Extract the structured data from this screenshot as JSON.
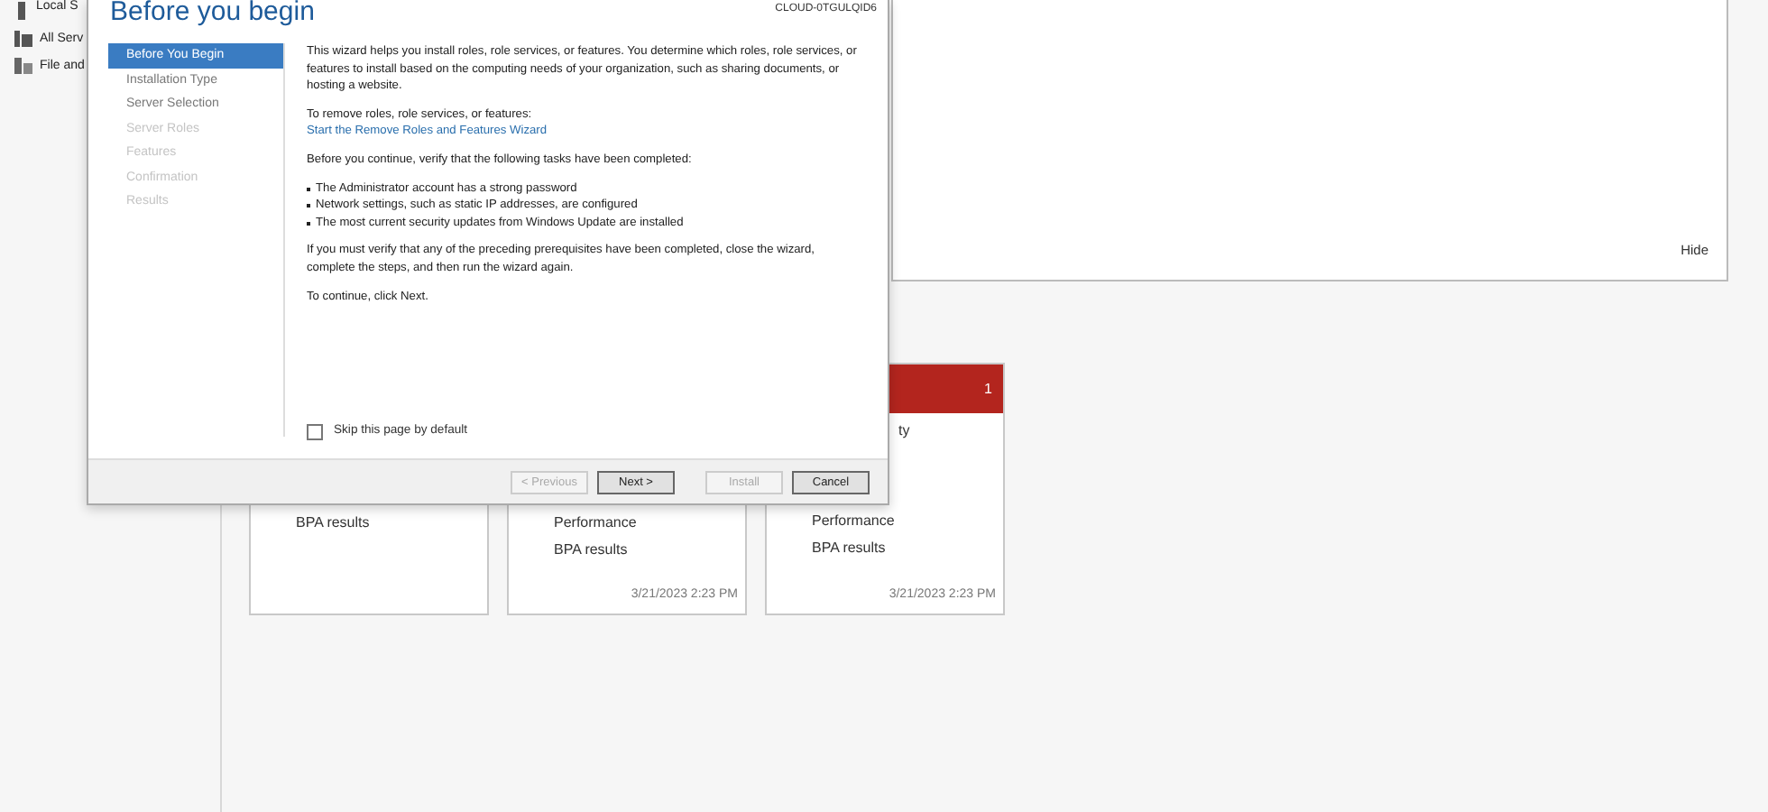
{
  "nav_items": [
    {
      "label": "Local S"
    },
    {
      "label": "All Serv"
    },
    {
      "label": "File and"
    }
  ],
  "panel": {
    "hide_link": "Hide"
  },
  "tiles": [
    {
      "items": [
        "BPA results"
      ]
    },
    {
      "items": [
        "Performance",
        "BPA results"
      ],
      "timestamp": "3/21/2023 2:23 PM"
    },
    {
      "alert": true,
      "count": "1",
      "partial_text": "ty",
      "items": [
        "Performance",
        "BPA results"
      ],
      "timestamp": "3/21/2023 2:23 PM"
    }
  ],
  "dialog": {
    "title": "Before you begin",
    "server_name": "CLOUD-0TGULQID6",
    "steps": [
      {
        "label": "Before You Begin",
        "selected": true,
        "disabled": false
      },
      {
        "label": "Installation Type",
        "selected": false,
        "disabled": false
      },
      {
        "label": "Server Selection",
        "selected": false,
        "disabled": false
      },
      {
        "label": "Server Roles",
        "selected": false,
        "disabled": true
      },
      {
        "label": "Features",
        "selected": false,
        "disabled": true
      },
      {
        "label": "Confirmation",
        "selected": false,
        "disabled": true
      },
      {
        "label": "Results",
        "selected": false,
        "disabled": true
      }
    ],
    "intro": "This wizard helps you install roles, role services, or features. You determine which roles, role services, or features to install based on the computing needs of your organization, such as sharing documents, or hosting a website.",
    "remove_label": "To remove roles, role services, or features:",
    "remove_link": "Start the Remove Roles and Features Wizard",
    "verify_text": "Before you continue, verify that the following tasks have been completed:",
    "tasks": [
      "The Administrator account has a strong password",
      "Network settings, such as static IP addresses, are configured",
      "The most current security updates from Windows Update are installed"
    ],
    "prereq_text": "If you must verify that any of the preceding prerequisites have been completed, close the wizard, complete the steps, and then run the wizard again.",
    "continue_text": "To continue, click Next.",
    "skip": {
      "label": "Skip this page by default",
      "checked": false
    },
    "buttons": [
      {
        "label": "< Previous",
        "disabled": true,
        "kind": "default"
      },
      {
        "label": "Next >",
        "disabled": false,
        "kind": "primary"
      },
      {
        "label": "Install",
        "disabled": true,
        "kind": "default"
      },
      {
        "label": "Cancel",
        "disabled": false,
        "kind": "primary"
      }
    ]
  }
}
